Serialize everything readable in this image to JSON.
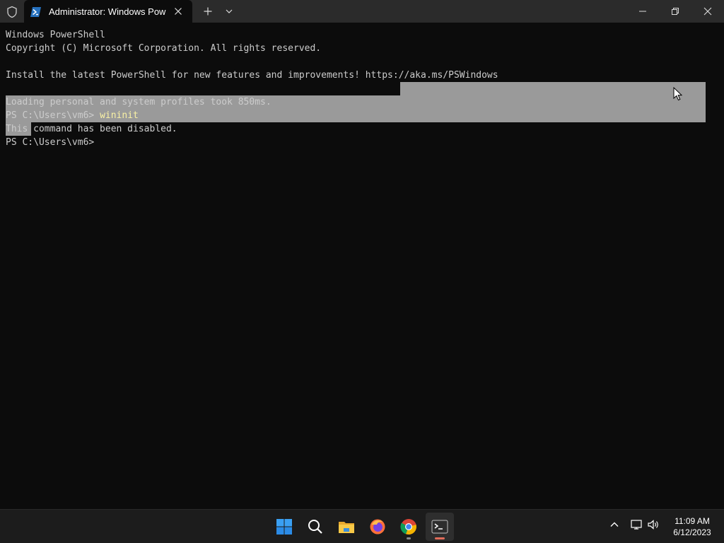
{
  "titlebar": {
    "tab_title": "Administrator: Windows PowerShell"
  },
  "terminal": {
    "lines": [
      "Windows PowerShell",
      "Copyright (C) Microsoft Corporation. All rights reserved.",
      "",
      "Install the latest PowerShell for new features and improvements! https://aka.ms/PSWindows",
      "",
      "Loading personal and system profiles took 850ms.",
      "PS C:\\Users\\vm6> ",
      "This command has been disabled.",
      "PS C:\\Users\\vm6>"
    ],
    "typed_command": "wininit"
  },
  "taskbar": {
    "time": "11:09 AM",
    "date": "6/12/2023"
  },
  "colors": {
    "background": "#0c0c0c",
    "text": "#cccccc",
    "command": "#f9f1a5",
    "selection": "#9a9a9a",
    "titlebar": "#2b2b2b",
    "taskbar": "#1c1c1c"
  },
  "icons": [
    "shield-icon",
    "powershell-icon",
    "close-icon",
    "plus-icon",
    "chevron-down-icon",
    "minimize-icon",
    "restore-icon",
    "start-icon",
    "search-icon",
    "file-explorer-icon",
    "firefox-icon",
    "chrome-icon",
    "terminal-icon",
    "chevron-up-icon",
    "network-icon",
    "volume-icon"
  ]
}
